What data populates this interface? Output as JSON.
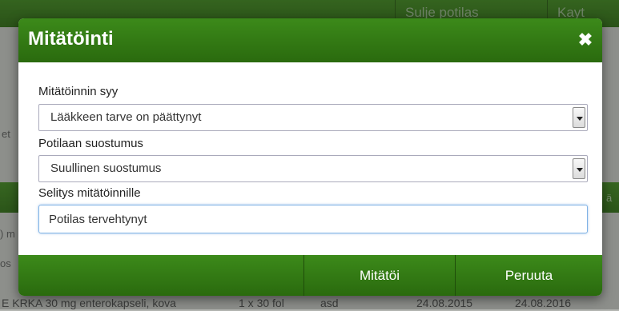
{
  "background": {
    "top_buttons": [
      "Sulje potilas",
      "Kayt"
    ],
    "fragments": [
      "et",
      "ä",
      ") m",
      "os"
    ],
    "bottom_row": {
      "name": "E KRKA 30 mg enterokapseli, kova",
      "amount": "1 x 30 fol",
      "note": "asd",
      "start": "24.08.2015",
      "end": "24.08.2016"
    }
  },
  "modal": {
    "title": "Mitätöinti",
    "close_icon": "close-icon",
    "fields": {
      "reason_label": "Mitätöinnin syy",
      "reason_value": "Lääkkeen tarve on päättynyt",
      "consent_label": "Potilaan suostumus",
      "consent_value": "Suullinen suostumus",
      "explanation_label": "Selitys mitätöinnille",
      "explanation_value": "Potilas tervehtynyt"
    },
    "footer": {
      "confirm_label": "Mitätöi",
      "cancel_label": "Peruuta"
    }
  },
  "colors": {
    "brand_green": "#2f7414",
    "input_focus": "#7fb2e5"
  }
}
